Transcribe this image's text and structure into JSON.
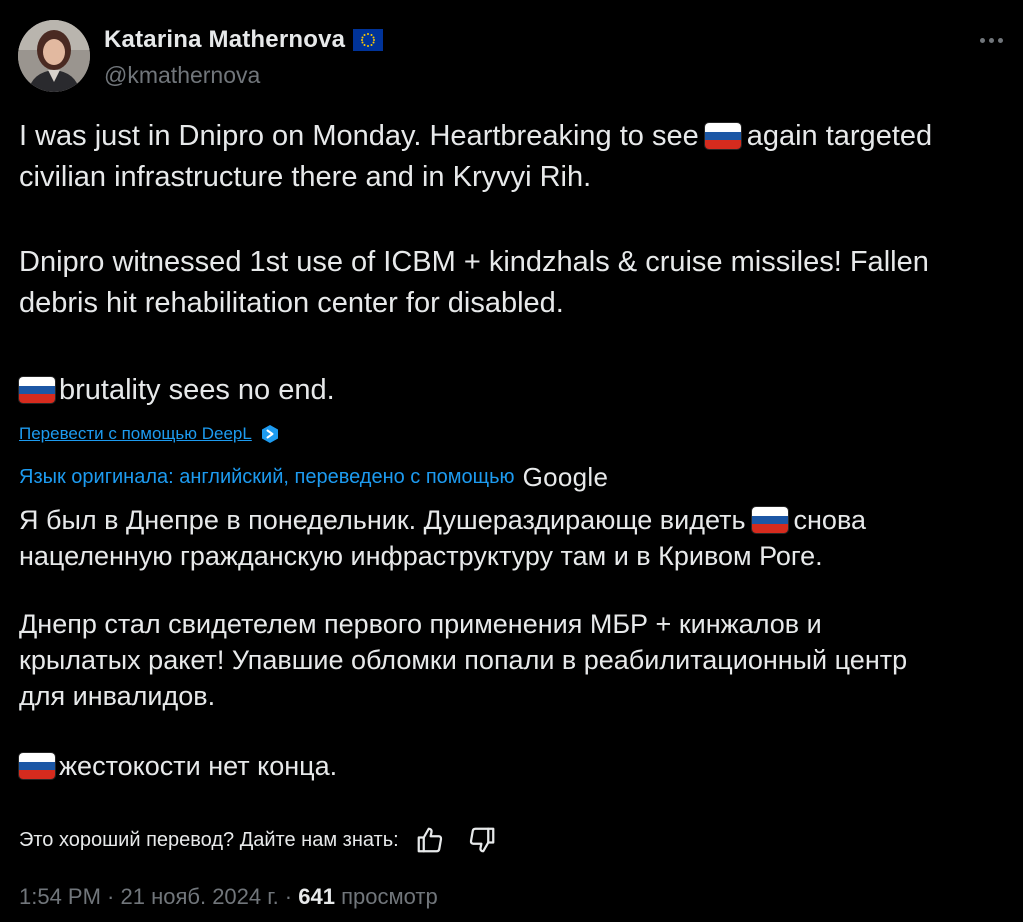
{
  "author": {
    "name": "Katarina Mathernova",
    "handle": "@kmathernova",
    "badge_icon": "eu-flag-icon",
    "avatar_icon": "avatar-photo"
  },
  "tweet": {
    "para1_a": "I was just in Dnipro on Monday. Heartbreaking to see",
    "para1_b": "again targeted",
    "para1_c": "civilian infrastructure there and in Kryvyi Rih.",
    "para2_a": "Dnipro witnessed 1st use of ICBM + kindzhals & cruise missiles! Fallen",
    "para2_b": "debris hit rehabilitation center for disabled.",
    "para3": "brutality sees no end."
  },
  "translate_link": "Перевести с помощью DeepL",
  "translation_info": "Язык оригинала: английский, переведено с помощью",
  "google_label": "Google",
  "translated": {
    "p1_a": "Я был в Днепре в понедельник. Душераздирающе видеть",
    "p1_b": "снова",
    "p1_c": "нацеленную гражданскую инфраструктуру там и в Кривом Роге.",
    "p2_a": "Днепр стал свидетелем первого применения МБР + кинжалов и",
    "p2_b": "крылатых ракет! Упавшие обломки попали в реабилитационный центр",
    "p2_c": "для инвалидов.",
    "p3": "жестокости нет конца."
  },
  "feedback": {
    "question": "Это хороший перевод? Дайте нам знать:",
    "like_icon": "thumbs-up-icon",
    "dislike_icon": "thumbs-down-icon"
  },
  "meta": {
    "time": "1:54 PM · 21 нояб. 2024 г. ·",
    "views_count": "641",
    "views_label": "просмотр"
  },
  "colors": {
    "background": "#000000",
    "text": "#e7e9ea",
    "secondary": "#71767b",
    "link": "#1d9bf0"
  }
}
